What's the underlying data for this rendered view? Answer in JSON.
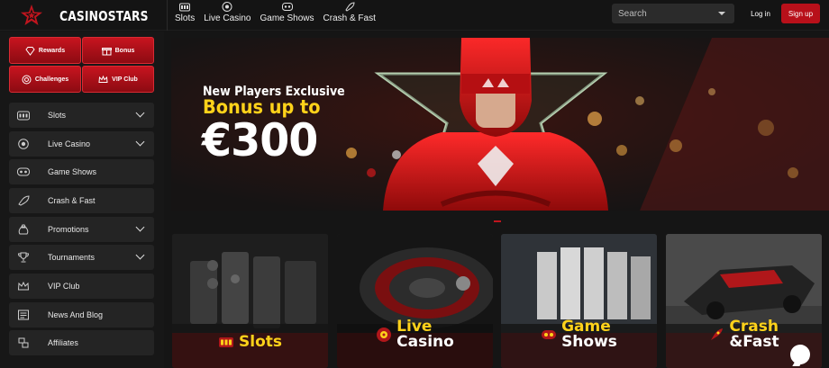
{
  "brand": {
    "name": "CASINOSTARS",
    "accent": "#c0151e",
    "highlight": "#ffd21a"
  },
  "topnav": [
    {
      "label": "Slots",
      "icon": "slot-machine-icon"
    },
    {
      "label": "Live Casino",
      "icon": "roulette-icon"
    },
    {
      "label": "Game Shows",
      "icon": "game-show-icon"
    },
    {
      "label": "Crash & Fast",
      "icon": "rocket-icon"
    }
  ],
  "search": {
    "placeholder": "Search"
  },
  "auth": {
    "login": "Log in",
    "signup": "Sign up"
  },
  "quick_links": [
    {
      "label": "Rewards",
      "icon": "diamond-icon"
    },
    {
      "label": "Bonus",
      "icon": "gift-icon"
    },
    {
      "label": "Challenges",
      "icon": "target-icon"
    },
    {
      "label": "VIP Club",
      "icon": "crown-icon"
    }
  ],
  "sidebar": {
    "items": [
      {
        "label": "Slots",
        "icon": "slot-machine-icon",
        "expandable": true
      },
      {
        "label": "Live Casino",
        "icon": "roulette-icon",
        "expandable": true
      },
      {
        "label": "Game Shows",
        "icon": "game-show-icon",
        "expandable": false
      },
      {
        "label": "Crash & Fast",
        "icon": "rocket-icon",
        "expandable": false
      },
      {
        "label": "Promotions",
        "icon": "money-bag-icon",
        "expandable": true
      },
      {
        "label": "Tournaments",
        "icon": "trophy-icon",
        "expandable": true
      },
      {
        "label": "VIP Club",
        "icon": "crown-icon",
        "expandable": false
      },
      {
        "label": "News And Blog",
        "icon": "news-icon",
        "expandable": false
      },
      {
        "label": "Affiliates",
        "icon": "affiliates-icon",
        "expandable": false
      }
    ]
  },
  "hero": {
    "line1": "New Players Exclusive",
    "line2": "Bonus up to",
    "line3": "€300"
  },
  "cards": [
    {
      "line1": "Slots",
      "line2": "",
      "icon": "slot-machine-icon"
    },
    {
      "line1": "Live",
      "line2": "Casino",
      "icon": "roulette-icon"
    },
    {
      "line1": "Game",
      "line2": "Shows",
      "icon": "game-show-icon"
    },
    {
      "line1": "Crash",
      "line2": "&Fast",
      "icon": "rocket-icon"
    }
  ]
}
